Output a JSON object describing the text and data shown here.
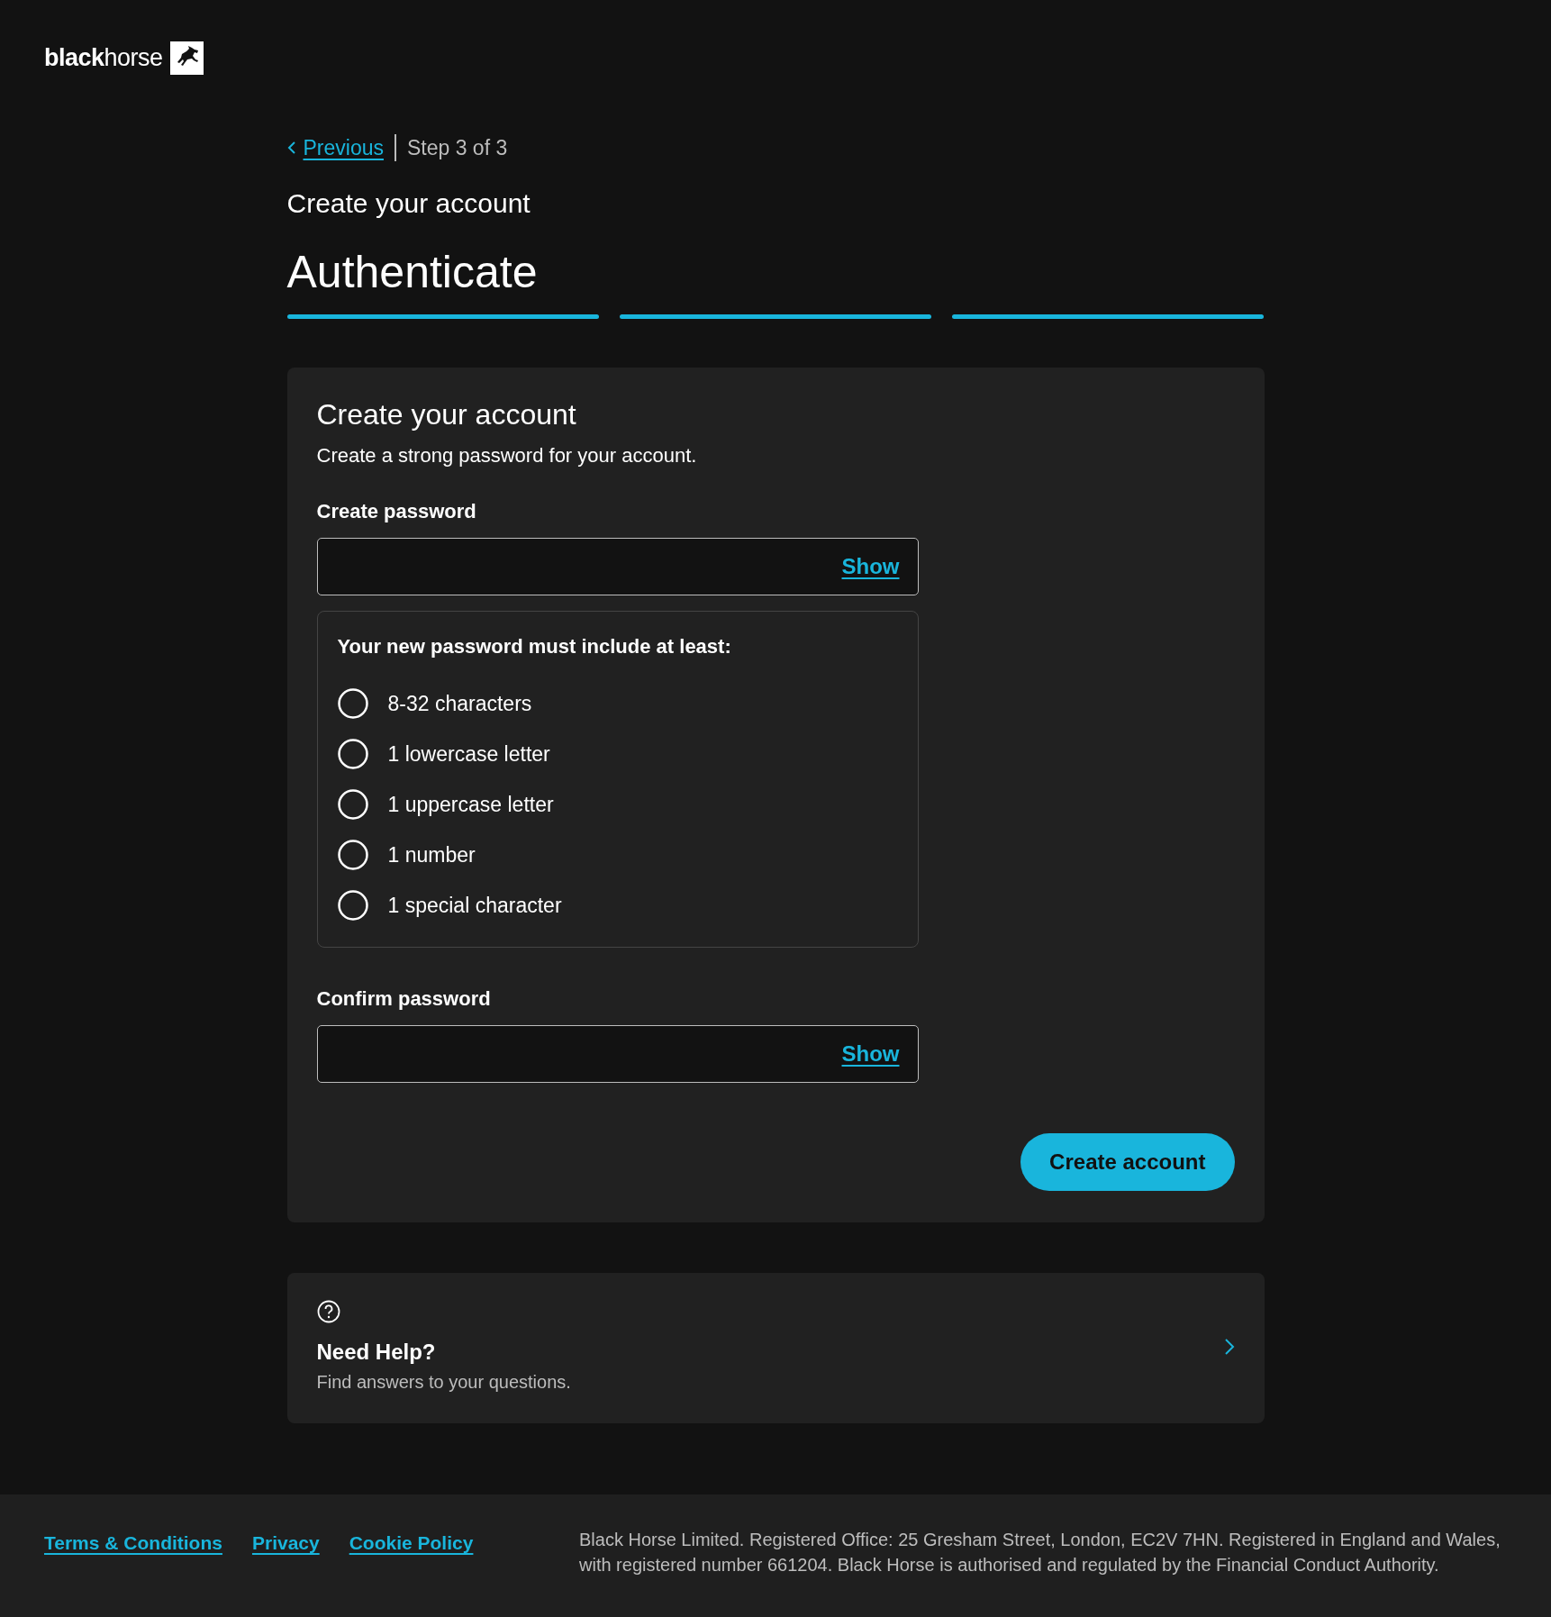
{
  "header": {
    "logo": "**black**horse"
  },
  "nav": {
    "back_link": "Previous",
    "step": "Step 3 of 3"
  },
  "page": {
    "subtitle": "Create your account",
    "title": "Authenticate"
  },
  "progress": [
    {
      "complete": true
    },
    {
      "complete": true
    },
    {
      "complete": true
    }
  ],
  "card": {
    "title": "Create your account",
    "description": "Create a strong password for your account.",
    "fields": [
      {
        "label": "Create password",
        "toggle": "Show",
        "requirements": {
          "heading": "Your new password must include at least:",
          "items": [
            {
              "text": "8-32 characters",
              "met": false
            },
            {
              "text": "1 lowercase letter",
              "met": false
            },
            {
              "text": "1 uppercase letter",
              "met": false
            },
            {
              "text": "1 number",
              "met": false
            },
            {
              "text": "1 special character",
              "met": false
            }
          ]
        }
      },
      {
        "label": "Confirm password",
        "toggle": "Show"
      }
    ],
    "button": "Create account"
  },
  "help": {
    "title": "Need Help?",
    "text": "Find answers to your questions."
  },
  "footer": {
    "links": [
      "Terms & Conditions",
      "Privacy",
      "Cookie Policy"
    ],
    "legal": "Black Horse Limited. Registered Office: 25 Gresham Street, London, EC2V 7HN. Registered in England and Wales, with registered number 661204. Black Horse is authorised and regulated by the Financial Conduct Authority."
  }
}
